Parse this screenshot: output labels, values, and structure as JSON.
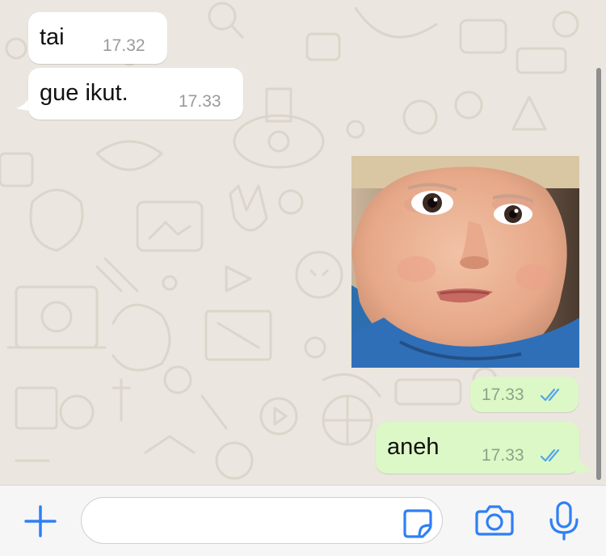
{
  "messages": [
    {
      "direction": "incoming",
      "text": "tai",
      "time": "17.32"
    },
    {
      "direction": "incoming",
      "text": "gue ikut.",
      "time": "17.33"
    },
    {
      "direction": "outgoing",
      "type": "photo",
      "time": "17.33",
      "status": "read"
    },
    {
      "direction": "outgoing",
      "text": "aneh",
      "time": "17.33",
      "status": "read"
    }
  ],
  "composer": {
    "placeholder": "",
    "icons": [
      "plus-icon",
      "sticker-icon",
      "camera-icon",
      "microphone-icon"
    ]
  },
  "colors": {
    "accent": "#2f7ff7",
    "outgoing_bubble": "#dcf8c6",
    "incoming_bubble": "#ffffff",
    "read_ticks": "#53a6e8",
    "background": "#ebe6df"
  }
}
